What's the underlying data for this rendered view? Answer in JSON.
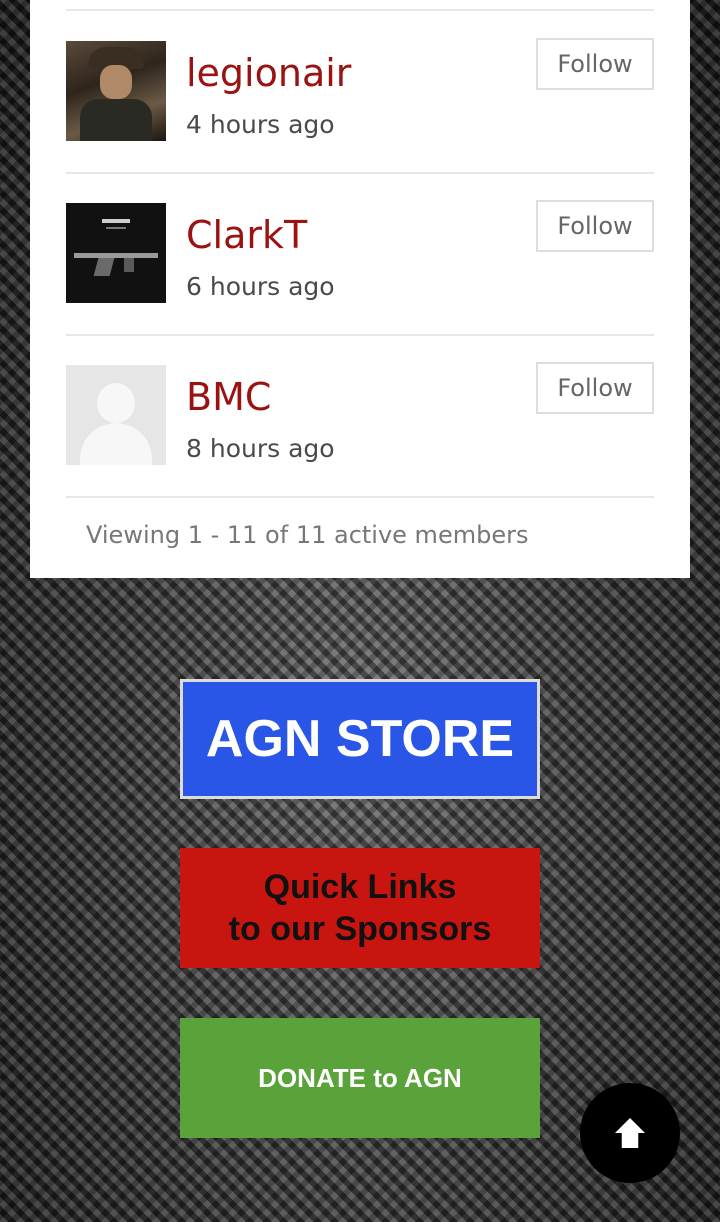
{
  "members": [
    {
      "name": "legionair",
      "time": "4 hours ago",
      "follow_label": "Follow",
      "avatar": "man-in-hat-photo"
    },
    {
      "name": "ClarkT",
      "time": "6 hours ago",
      "follow_label": "Follow",
      "avatar": "rifle-photo"
    },
    {
      "name": "BMC",
      "time": "8 hours ago",
      "follow_label": "Follow",
      "avatar": "default-avatar"
    }
  ],
  "viewing_text": "Viewing 1 - 11 of 11 active members",
  "banners": {
    "store": "AGN STORE",
    "sponsors_line1": "Quick Links",
    "sponsors_line2": "to our Sponsors",
    "donate": "DONATE to AGN"
  },
  "icons": {
    "back_to_top": "arrow-up-icon"
  },
  "colors": {
    "member_name": "#9b1212",
    "store_banner": "#2a56e8",
    "sponsors_banner": "#c8150f",
    "donate_banner": "#5aa23a"
  }
}
